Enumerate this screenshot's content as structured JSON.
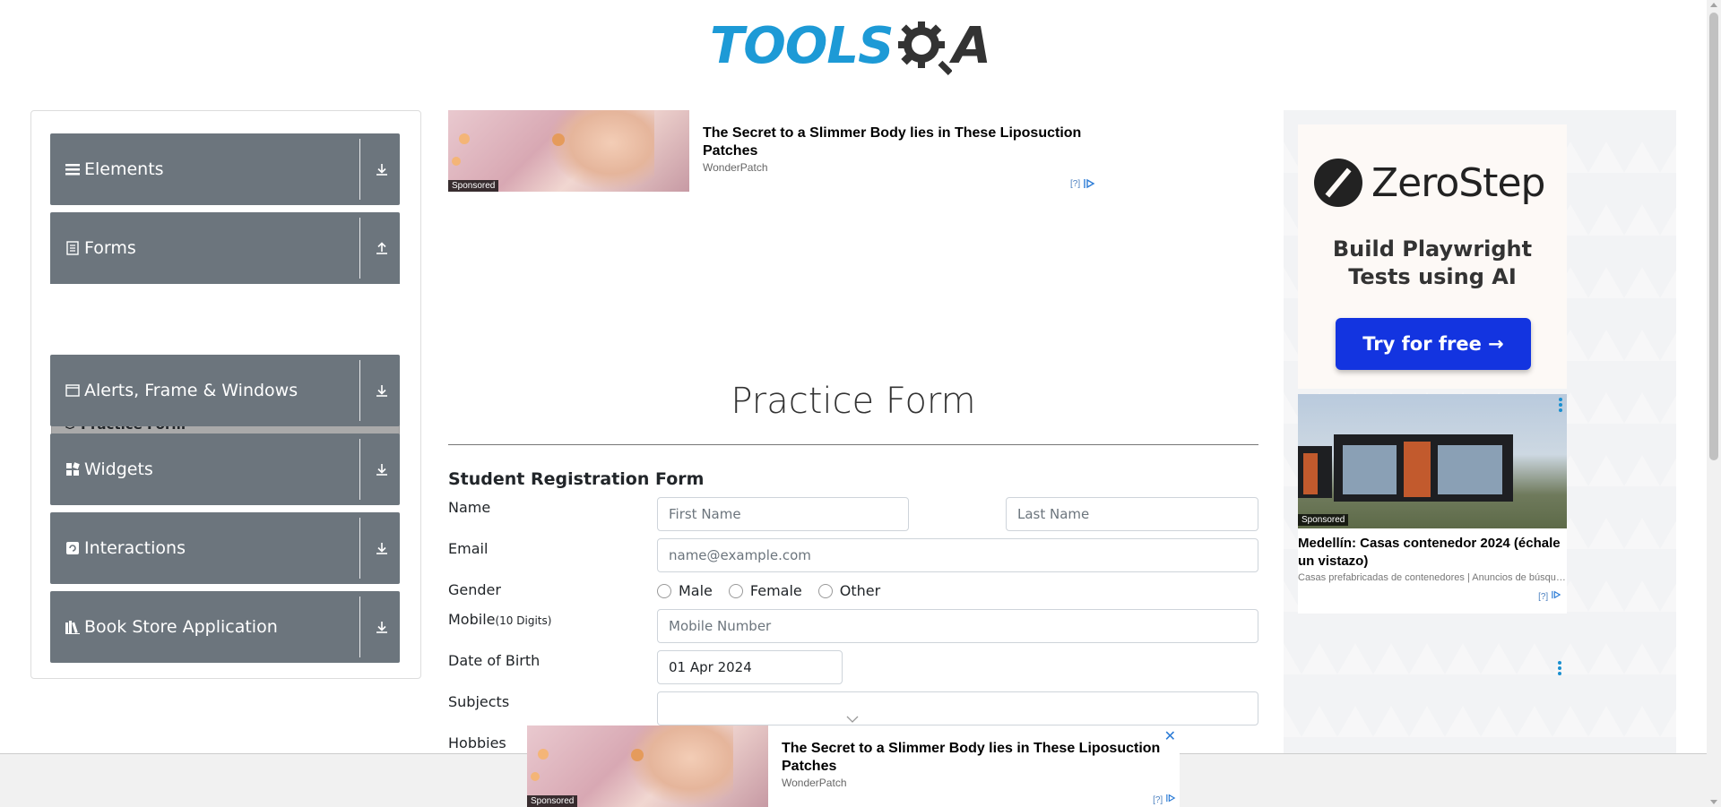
{
  "header": {
    "logo_text": "TOOLS",
    "logo_suffix": "A"
  },
  "nav": {
    "groups": [
      {
        "label": "Elements",
        "icon": "hamburger-icon",
        "toggle": "download-icon"
      },
      {
        "label": "Forms",
        "icon": "document-icon",
        "toggle": "upload-icon"
      },
      {
        "label": "Alerts, Frame & Windows",
        "icon": "window-icon",
        "toggle": "download-icon"
      },
      {
        "label": "Widgets",
        "icon": "widgets-icon",
        "toggle": "download-icon"
      },
      {
        "label": "Interactions",
        "icon": "interactions-icon",
        "toggle": "download-icon"
      },
      {
        "label": "Book Store Application",
        "icon": "books-icon",
        "toggle": "download-icon"
      }
    ],
    "active_item": {
      "label": "Practice Form",
      "icon": "html-icon"
    }
  },
  "top_ad": {
    "title": "The Secret to a Slimmer Body lies in These Liposuction Patches",
    "brand": "WonderPatch",
    "sponsored": "Sponsored",
    "info": "[?]"
  },
  "page": {
    "title": "Practice Form",
    "form_heading": "Student Registration Form"
  },
  "form": {
    "name_label": "Name",
    "first_name_placeholder": "First Name",
    "last_name_placeholder": "Last Name",
    "email_label": "Email",
    "email_placeholder": "name@example.com",
    "gender_label": "Gender",
    "gender_options": [
      "Male",
      "Female",
      "Other"
    ],
    "mobile_label": "Mobile",
    "mobile_hint": "(10 Digits)",
    "mobile_placeholder": "Mobile Number",
    "dob_label": "Date of Birth",
    "dob_value": "01 Apr 2024",
    "subjects_label": "Subjects",
    "hobbies_label": "Hobbies"
  },
  "right_ad": {
    "brand": "ZeroStep",
    "tagline": "Build Playwright Tests using AI",
    "cta": "Try for free →",
    "card_title": "Medellín: Casas contenedor 2024 (échale un vistazo)",
    "card_desc": "Casas prefabricadas de contenedores | Anuncios de búsqueda",
    "sponsored": "Sponsored",
    "info": "[?]"
  },
  "sticky_ad": {
    "title": "The Secret to a Slimmer Body lies in These Liposuction Patches",
    "brand": "WonderPatch",
    "sponsored": "Sponsored",
    "close": "✕",
    "info": "[?]"
  },
  "colors": {
    "brand_blue": "#1d9ad6",
    "nav_bg": "#6c757d",
    "active_item_bg": "#aaaaaa",
    "cta_blue": "#1334e0"
  }
}
